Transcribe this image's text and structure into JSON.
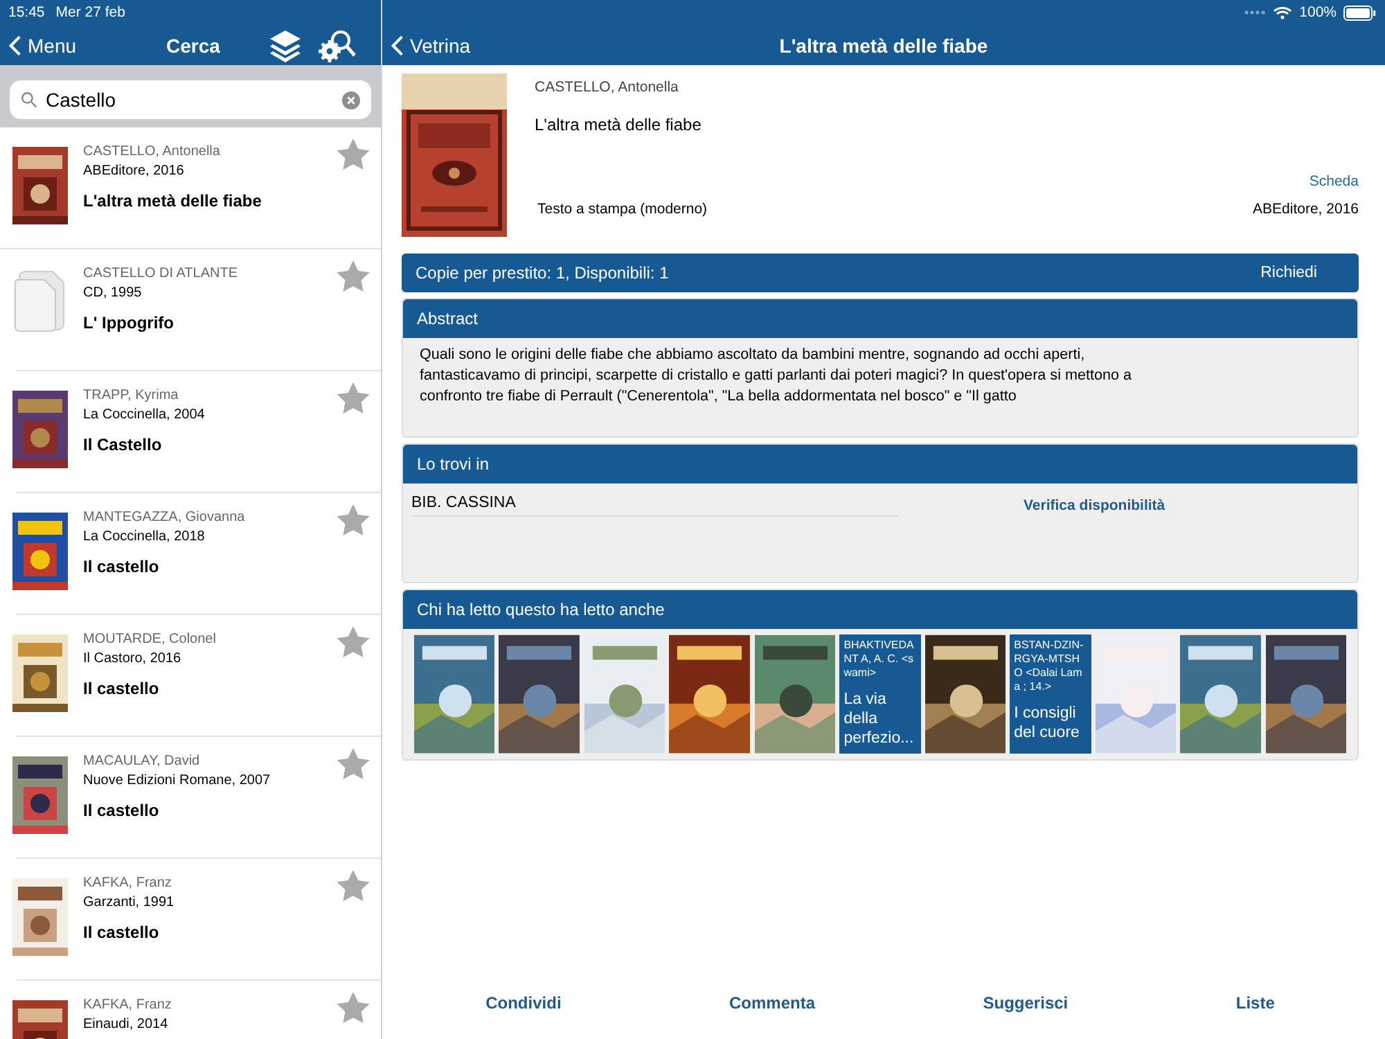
{
  "status_bar": {
    "time": "15:45",
    "date": "Mer 27 feb",
    "battery": "100%"
  },
  "left_nav": {
    "back": "Menu",
    "title": "Cerca"
  },
  "search": {
    "value": "Castello"
  },
  "results": [
    {
      "author": "CASTELLO, Antonella",
      "publisher": "ABEditore, 2016",
      "title": "L'altra metà delle fiabe",
      "kind": "picture"
    },
    {
      "author": "CASTELLO DI ATLANTE",
      "publisher": "CD, 1995",
      "title": "L' Ippogrifo",
      "kind": "document"
    },
    {
      "author": "TRAPP, Kyrima",
      "publisher": "La Coccinella, 2004",
      "title": "Il Castello",
      "kind": "picture"
    },
    {
      "author": "MANTEGAZZA, Giovanna",
      "publisher": "La Coccinella, 2018",
      "title": "Il castello",
      "kind": "picture"
    },
    {
      "author": "MOUTARDE, Colonel",
      "publisher": "Il Castoro, 2016",
      "title": "Il castello",
      "kind": "picture"
    },
    {
      "author": "MACAULAY, David",
      "publisher": "Nuove Edizioni Romane, 2007",
      "title": "Il castello",
      "kind": "picture"
    },
    {
      "author": "KAFKA, Franz",
      "publisher": "Garzanti, 1991",
      "title": "Il castello",
      "kind": "picture"
    },
    {
      "author": "KAFKA, Franz",
      "publisher": "Einaudi, 2014",
      "kind": "picture"
    }
  ],
  "right_nav": {
    "back": "Vetrina",
    "title": "L'altra metà delle fiabe"
  },
  "record": {
    "author": "CASTELLO, Antonella",
    "title": "L'altra metà delle fiabe",
    "link": "Scheda",
    "type": "Testo a stampa (moderno)",
    "publisher": "ABEditore, 2016"
  },
  "copies": {
    "text": "Copie per prestito: 1, Disponibili: 1",
    "action": "Richiedi"
  },
  "abstract": {
    "heading": "Abstract",
    "text": "Quali sono le origini delle fiabe che abbiamo ascoltato da bambini mentre, sognando ad occhi aperti, fantasticavamo di principi, scarpette di cristallo e gatti parlanti dai poteri magici? In quest'opera si mettono a confronto tre fiabe di Perrault (\"Cenerentola\", \"La bella addormentata nel bosco\" e \"Il gatto"
  },
  "locations": {
    "heading": "Lo trovi in",
    "library": "BIB. CASSINA",
    "action": "Verifica disponibilità"
  },
  "also_read": {
    "heading": "Chi ha letto questo ha letto anche",
    "items": [
      {
        "kind": "picture"
      },
      {
        "kind": "picture"
      },
      {
        "kind": "picture"
      },
      {
        "kind": "picture"
      },
      {
        "kind": "picture"
      },
      {
        "kind": "text",
        "author": "BHAKTIVEDANT A, A. C. <swami>",
        "title": "La via della perfezio..."
      },
      {
        "kind": "picture"
      },
      {
        "kind": "text",
        "author": "BSTAN-DZIN-RGYA-MTSHO <Dalai Lama ; 14.>",
        "title": "I consigli del cuore"
      },
      {
        "kind": "picture"
      },
      {
        "kind": "picture"
      },
      {
        "kind": "picture"
      }
    ]
  },
  "toolbar": [
    "Condividi",
    "Commenta",
    "Suggerisci",
    "Liste"
  ]
}
